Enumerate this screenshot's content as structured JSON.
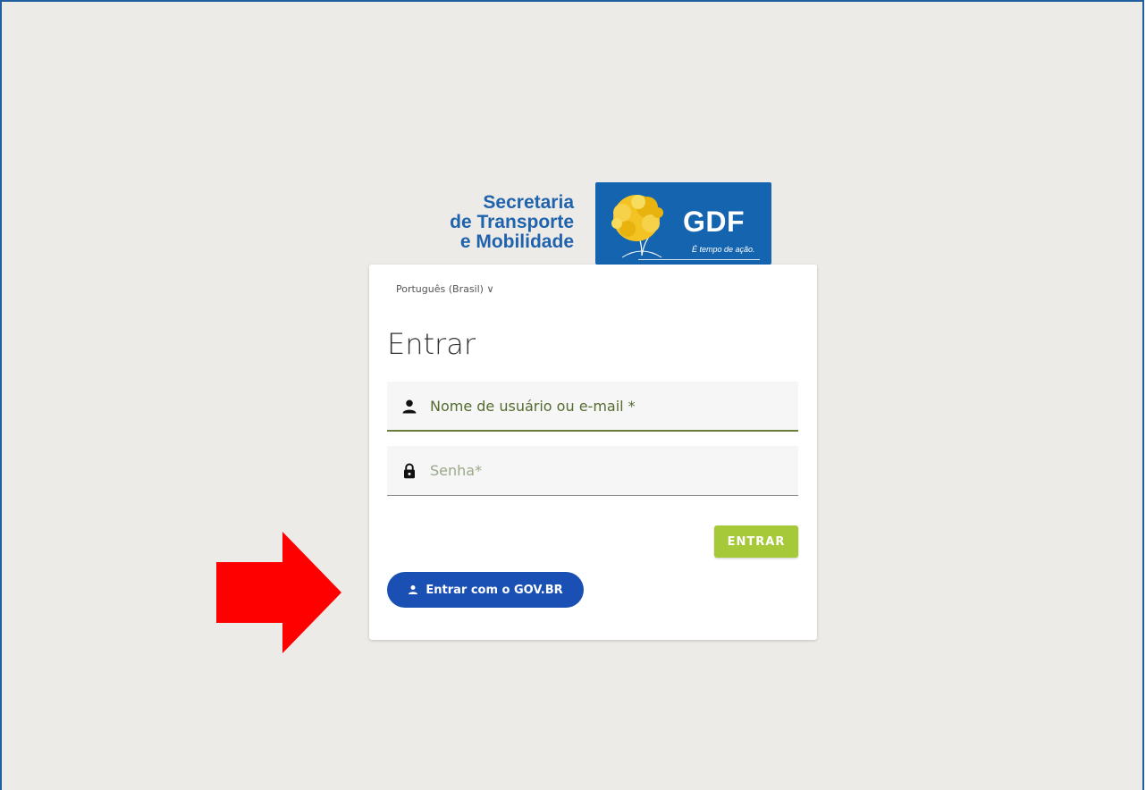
{
  "logo": {
    "lines": [
      "Secretaria",
      "de Transporte",
      "e Mobilidade"
    ],
    "gdf": "GDF",
    "slogan": "É tempo de ação."
  },
  "login": {
    "language": "Português (Brasil) ∨",
    "title": "Entrar",
    "username_label": "Nome de usuário ou e-mail *",
    "password_label": "Senha*",
    "submit_label": "ENTRAR",
    "govbr_label": "Entrar com o GOV.BR"
  },
  "colors": {
    "background": "#edebe8",
    "brand_blue": "#1564b0",
    "submit_green": "#a6c93a",
    "govbr_blue": "#1a4fb3",
    "arrow_red": "#ff0000"
  },
  "icons": [
    "user-icon",
    "lock-icon",
    "govbr-user-icon",
    "tree-logo-icon",
    "red-arrow-icon"
  ]
}
